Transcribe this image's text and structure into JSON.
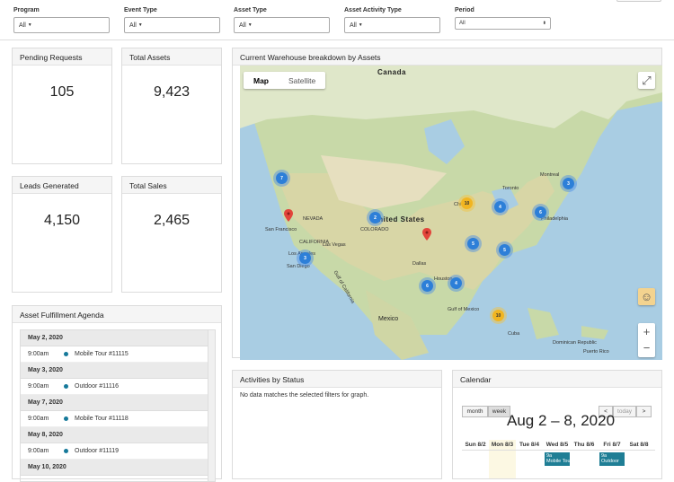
{
  "filters": {
    "program": {
      "label": "Program",
      "value": "All"
    },
    "event_type": {
      "label": "Event Type",
      "value": "All"
    },
    "asset_type": {
      "label": "Asset Type",
      "value": "All"
    },
    "asset_activity_type": {
      "label": "Asset Activity Type",
      "value": "All"
    },
    "period": {
      "label": "Period",
      "value": "All"
    }
  },
  "kpis": {
    "pending_requests": {
      "label": "Pending Requests",
      "value": "105"
    },
    "total_assets": {
      "label": "Total Assets",
      "value": "9,423"
    },
    "leads_generated": {
      "label": "Leads Generated",
      "value": "4,150"
    },
    "total_sales": {
      "label": "Total Sales",
      "value": "2,465"
    }
  },
  "map_panel": {
    "title": "Current Warehouse breakdown by Assets",
    "tabs": [
      "Map",
      "Satellite"
    ],
    "labels": {
      "canada": "Canada",
      "united_states": "United States",
      "mexico": "Mexico",
      "cuba": "Cuba",
      "san_francisco": "San Francisco",
      "los_angeles": "Los Angeles",
      "san_diego": "San Diego",
      "las_vegas": "Las Vegas",
      "nevada": "NEVADA",
      "california": "CALIFORNIA",
      "colorado": "COLORADO",
      "dallas": "Dallas",
      "houston": "Houston",
      "toronto": "Toronto",
      "montreal": "Montreal",
      "chicago": "Chicago",
      "philadelphia": "Philadelphia",
      "dominican_republic": "Dominican Republic",
      "puerto_rico": "Puerto Rico",
      "gulf_of_mexico": "Gulf of Mexico",
      "gulf_of_california": "Gulf of California"
    },
    "clusters": [
      "7",
      "2",
      "10",
      "4",
      "3",
      "6",
      "5",
      "5",
      "3",
      "4",
      "6",
      "10"
    ]
  },
  "agenda": {
    "title": "Asset Fulfillment Agenda",
    "days": [
      {
        "date": "May 2, 2020",
        "time": "9:00am",
        "event": "Mobile Tour #11115"
      },
      {
        "date": "May 3, 2020",
        "time": "9:00am",
        "event": "Outdoor #11116"
      },
      {
        "date": "May 7, 2020",
        "time": "9:00am",
        "event": "Mobile Tour #11118"
      },
      {
        "date": "May 8, 2020",
        "time": "9:00am",
        "event": "Outdoor #11119"
      },
      {
        "date": "May 10, 2020",
        "time": "",
        "event": ""
      }
    ]
  },
  "activities": {
    "title": "Activities by Status",
    "empty_message": "No data matches the selected filters for graph."
  },
  "calendar": {
    "title": "Calendar",
    "month_btn": "month",
    "week_btn": "week",
    "today_btn": "today",
    "prev": "<",
    "next": ">",
    "range": "Aug 2 – 8, 2020",
    "days": [
      "Sun 8/2",
      "Mon 8/3",
      "Tue 8/4",
      "Wed 8/5",
      "Thu 8/6",
      "Fri 8/7",
      "Sat 8/8"
    ],
    "events": [
      {
        "time": "9a",
        "label": "Mobile Tour"
      },
      {
        "time": "9a",
        "label": "Outdoor"
      }
    ]
  },
  "colors": {
    "accent": "#1f7e95",
    "cluster_blue": "#2d7fd8",
    "cluster_yellow": "#f1b521",
    "pin_red": "#e2443a"
  }
}
